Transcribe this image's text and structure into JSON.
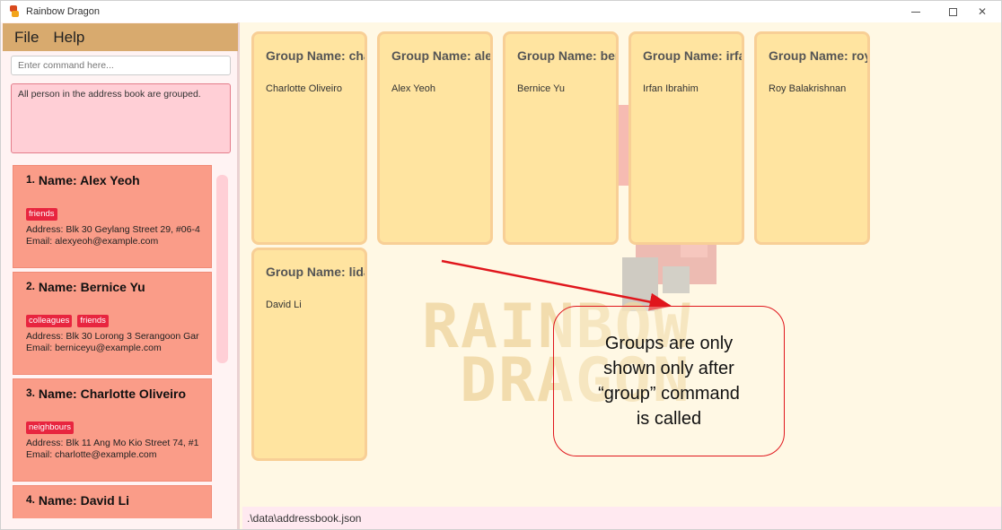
{
  "window": {
    "title": "Rainbow Dragon"
  },
  "menu": {
    "file": "File",
    "help": "Help"
  },
  "command": {
    "placeholder": "Enter command here..."
  },
  "result": {
    "text": "All person in the address book are grouped."
  },
  "persons": [
    {
      "index": "1.",
      "name": "Name: Alex Yeoh",
      "tags": [
        "friends"
      ],
      "address": "Address: Blk 30 Geylang Street 29, #06-4",
      "email": "Email: alexyeoh@example.com"
    },
    {
      "index": "2.",
      "name": "Name: Bernice Yu",
      "tags": [
        "colleagues",
        "friends"
      ],
      "address": "Address: Blk 30 Lorong 3 Serangoon Gar",
      "email": "Email: berniceyu@example.com"
    },
    {
      "index": "3.",
      "name": "Name: Charlotte Oliveiro",
      "tags": [
        "neighbours"
      ],
      "address": "Address: Blk 11 Ang Mo Kio Street 74, #1",
      "email": "Email: charlotte@example.com"
    },
    {
      "index": "4.",
      "name": "Name: David Li"
    }
  ],
  "groups": [
    {
      "title": "Group Name: cha",
      "member": "Charlotte Oliveiro"
    },
    {
      "title": "Group Name: ale",
      "member": "Alex Yeoh"
    },
    {
      "title": "Group Name: ber",
      "member": "Bernice Yu"
    },
    {
      "title": "Group Name: irfa",
      "member": "Irfan Ibrahim"
    },
    {
      "title": "Group Name: roy",
      "member": "Roy Balakrishnan"
    },
    {
      "title": "Group Name: lida",
      "member": "David Li"
    }
  ],
  "watermark": {
    "line1": "RAINBOW",
    "line2": "DRAGON"
  },
  "annotation": {
    "lines": [
      "Groups are only",
      "shown only after",
      "“group” command",
      "is called"
    ],
    "color": "#e0161c"
  },
  "status": {
    "path": ".\\data\\addressbook.json"
  },
  "colors": {
    "menubar": "#d8aa6e",
    "person_card": "#fa9c88",
    "tag": "#e8253f",
    "group_card": "#ffe4a0",
    "group_border": "#f8cf96",
    "result_box": "#ffcfd6"
  }
}
